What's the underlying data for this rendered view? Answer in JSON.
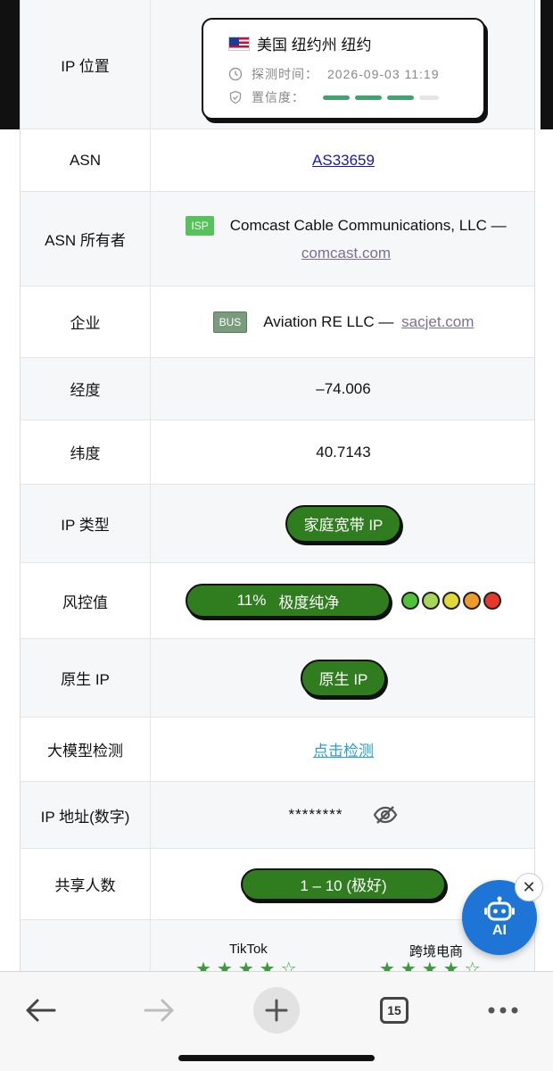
{
  "rows": {
    "ip_location": {
      "label": "IP 位置",
      "country_flag_icon": "us-flag-icon",
      "location": "美国 纽约州 纽约",
      "detect_time_label": "探测时间：",
      "detect_time": "2026-09-03 11:19",
      "confidence_label": "置信度：",
      "confidence_bars": {
        "filled": 3,
        "total": 4
      }
    },
    "asn": {
      "label": "ASN",
      "value": "AS33659"
    },
    "asn_owner": {
      "label": "ASN 所有者",
      "tag": "ISP",
      "name": "Comcast Cable Communications, LLC —",
      "domain": "comcast.com"
    },
    "company": {
      "label": "企业",
      "tag": "BUS",
      "name": "Aviation RE LLC —",
      "domain": "sacjet.com"
    },
    "longitude": {
      "label": "经度",
      "value": "–74.006"
    },
    "latitude": {
      "label": "纬度",
      "value": "40.7143"
    },
    "ip_type": {
      "label": "IP 类型",
      "value": "家庭宽带 IP"
    },
    "risk": {
      "label": "风控值",
      "percent": "11%",
      "text": "极度纯净",
      "scale_colors": [
        "#4fc23a",
        "#a8d65a",
        "#e1d83a",
        "#ef9a2a",
        "#e53a2a"
      ]
    },
    "native_ip": {
      "label": "原生 IP",
      "value": "原生 IP"
    },
    "llm_detect": {
      "label": "大模型检测",
      "value": "点击检测"
    },
    "ip_numeric": {
      "label": "IP 地址(数字)",
      "value": "********"
    },
    "shared_users": {
      "label": "共享人数",
      "value": "1 – 10 (极好)"
    },
    "platforms": {
      "tiktok": "TikTok",
      "cross_border": "跨境电商"
    }
  },
  "ai_fab": {
    "label": "AI"
  },
  "browser_bar": {
    "tab_count": "15"
  },
  "colors": {
    "pill_green": "#2f7d1f",
    "link_blue": "#1a1aa6",
    "fab_blue": "#1e75d6"
  }
}
